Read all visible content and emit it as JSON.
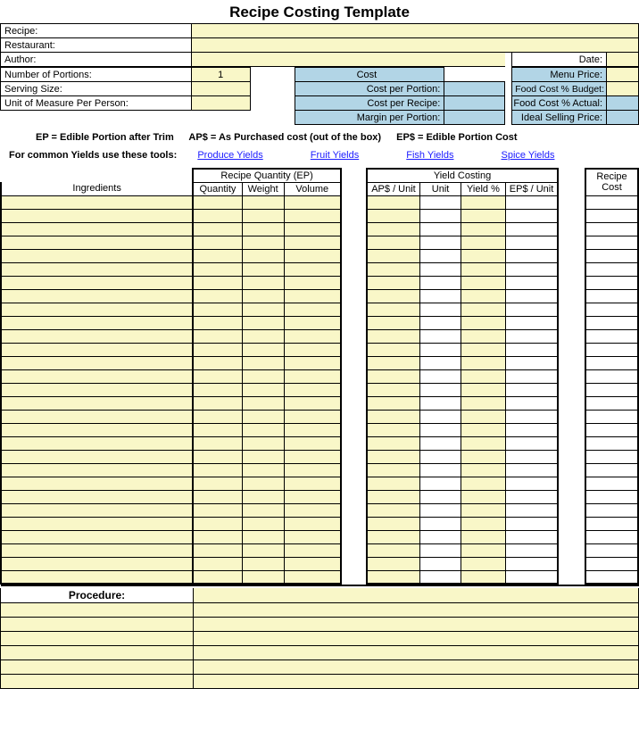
{
  "title": "Recipe Costing Template",
  "header": {
    "recipe_label": "Recipe:",
    "recipe_value": "",
    "restaurant_label": "Restaurant:",
    "restaurant_value": "",
    "author_label": "Author:",
    "author_value": "",
    "date_label": "Date:",
    "date_value": "",
    "portions_label": "Number of Portions:",
    "portions_value": "1",
    "serving_label": "Serving Size:",
    "serving_value": "",
    "uom_label": "Unit of Measure Per Person:",
    "uom_value": ""
  },
  "cost_block": {
    "cost_label": "Cost",
    "cost_portion_label": "Cost per Portion:",
    "cost_portion_value": "",
    "cost_recipe_label": "Cost per Recipe:",
    "cost_recipe_value": "",
    "margin_label": "Margin per Portion:",
    "margin_value": ""
  },
  "price_block": {
    "menu_price_label": "Menu Price:",
    "menu_price_value": "",
    "budget_label": "Food Cost % Budget:",
    "budget_value": "",
    "actual_label": "Food Cost % Actual:",
    "actual_value": "",
    "ideal_label": "Ideal Selling Price:",
    "ideal_value": ""
  },
  "defs": {
    "ep": "EP = Edible Portion after Trim",
    "aps": "AP$ = As Purchased cost (out of the box)",
    "epc": "EP$ = Edible Portion Cost"
  },
  "tools": {
    "label": "For common Yields use these tools:",
    "links": [
      "Produce Yields",
      "Fruit Yields",
      "Fish Yields",
      "Spice Yields"
    ]
  },
  "table_headers": {
    "ingredients": "Ingredients",
    "recipe_qty": "Recipe Quantity (EP)",
    "quantity": "Quantity",
    "weight": "Weight",
    "volume": "Volume",
    "yield_costing": "Yield Costing",
    "ap_unit": "AP$ / Unit",
    "unit": "Unit",
    "yield_pct": "Yield %",
    "ep_unit": "EP$ / Unit",
    "recipe_cost": "Recipe Cost"
  },
  "ingredient_rows": 29,
  "procedure_label": "Procedure:",
  "procedure_rows": 6
}
